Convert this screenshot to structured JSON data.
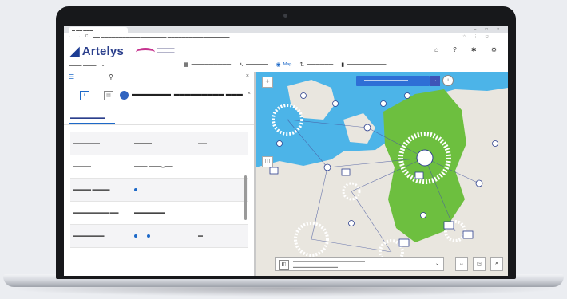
{
  "browser": {
    "tab_title": "▬ ▬▬ ▬▬▬",
    "window_controls": "– □ ×",
    "nav_buttons": "← → C",
    "url": "▬▬ ▬▬▬▬▬▬▬▬▬▬▬ ▬▬▬▬▬▬▬ ▬▬▬▬▬▬▬▬▬▬ ▬▬▬▬▬▬▬",
    "ext_icons": "☆ ⋮ ◻ ⋮"
  },
  "header": {
    "brand_logo_glyph": "◢",
    "brand_name": "Artelys",
    "partner_text": "▬▬▬▬▬ ▬▬▬▬▬",
    "icons": "⌂ ? ✱ ⚙"
  },
  "toolbar": {
    "workspace_select": "▬▬▬ ▬▬▬",
    "chevron": "⌄",
    "items": [
      {
        "icon": "▦",
        "label": "▬▬▬▬▬▬▬▬▬"
      },
      {
        "icon": "↖",
        "label": "▬▬▬▬▬"
      },
      {
        "icon": "◉",
        "label": "Map"
      },
      {
        "icon": "⇅",
        "label": "▬▬▬▬▬▬"
      },
      {
        "icon": "▮",
        "label": "▬▬▬▬▬▬▬▬▬"
      }
    ]
  },
  "left_panel": {
    "icon_left": "☰",
    "icon_mid": "⚲",
    "close": "×",
    "back": "⟨",
    "doc": "▤",
    "asset_name": "▬▬▬▬▬▬▬_▬▬▬▬▬▬▬▬▬ ▬▬▬",
    "asset_close": "×",
    "tab_label": "▬▬▬▬▬▬▬▬",
    "properties": [
      {
        "key": "▬▬▬▬▬▬",
        "value": "▬▬▬▬",
        "unit": "▬▬"
      },
      {
        "key": "▬▬▬▬",
        "value": "▬▬▬ ▬▬▬_▬▬",
        "unit": ""
      },
      {
        "key": "▬▬▬▬ ▬▬▬▬",
        "value": "",
        "unit": ""
      },
      {
        "key": "▬▬▬▬▬▬▬▬ ▬▬",
        "value": "▬▬▬▬▬▬▬",
        "unit": ""
      },
      {
        "key": "▬▬▬▬▬▬▬",
        "value": "",
        "unit": "▬"
      }
    ]
  },
  "map": {
    "primary_button": "▬▬▬▬▬▬▬▬▬▬",
    "secondary_button": "⌄",
    "info_button": "i",
    "zoom_button": "+",
    "layer_button": "◫",
    "bottom_icon": "◧",
    "bottom_title": "▬▬▬▬▬▬▬▬▬▬▬▬▬▬▬▬▬▬",
    "bottom_sub": "▬▬▬▬▬▬▬▬▬▬▬▬▬▬",
    "bottom_chevron": "⌄",
    "controls": [
      "↔",
      "◳",
      "✕"
    ],
    "colors": {
      "sea": "#4cb4e8",
      "land": "#e9e6df",
      "highlighted_country": "#6dbf3f",
      "node": "#ffffff",
      "node_border": "#2c3f8e",
      "link": "#4a5aa0"
    }
  }
}
